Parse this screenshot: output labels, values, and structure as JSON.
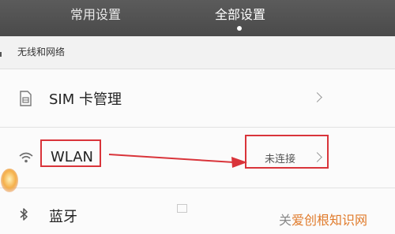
{
  "tabs": {
    "common_label": "常用设置",
    "all_label": "全部设置"
  },
  "section": {
    "title": "无线和网络"
  },
  "rows": {
    "sim": {
      "label": "SIM 卡管理",
      "icon": "sim-card-icon"
    },
    "wlan": {
      "label": "WLAN",
      "status": "未连接",
      "icon": "wifi-icon"
    },
    "bluetooth": {
      "label": "蓝牙",
      "icon": "bluetooth-icon"
    }
  },
  "annotation": {
    "color": "#d9343a"
  },
  "watermark": {
    "prefix": "关",
    "text": "爱创根知识网"
  },
  "colors": {
    "topbar": "#4f4f4f",
    "background": "#f7f7f7"
  }
}
